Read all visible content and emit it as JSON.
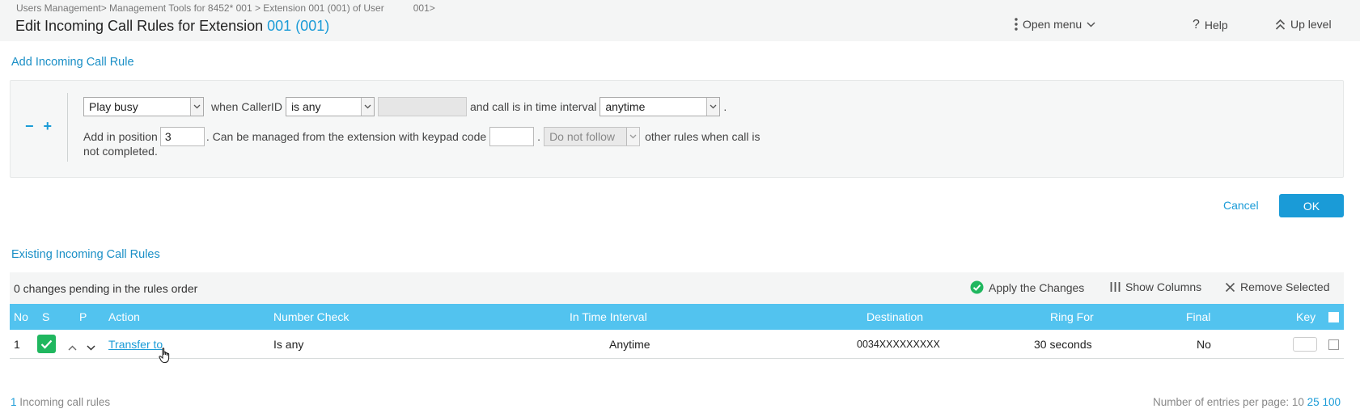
{
  "header": {
    "breadcrumb": "Users Management> Management Tools for 8452* 001 > Extension 001 (001) of User",
    "breadcrumb_tail": "001>",
    "title": "Edit Incoming Call Rules for Extension",
    "title_ext": "001 (001)",
    "open_menu": "Open menu",
    "help": "Help",
    "up_level": "Up level"
  },
  "add_rule": {
    "section_title": "Add Incoming Call Rule",
    "minus": "−",
    "plus": "+",
    "action_value": "Play busy",
    "when_callerid": "when CallerID",
    "callerid_condition": "is any",
    "callerid_value": "",
    "and_call_time": "and call is in time interval",
    "time_interval": "anytime",
    "period": ".",
    "add_in_position": "Add in position",
    "position_value": "3",
    "managed_text": ". Can be managed from the extension with keypad code",
    "keypad_code": "",
    "follow_value": "Do not follow",
    "other_rules_text": "other rules when call is",
    "not_completed": "not completed.",
    "cancel": "Cancel",
    "ok": "OK"
  },
  "existing": {
    "section_title": "Existing Incoming Call Rules",
    "changes_pending": "0 changes pending in the rules order",
    "apply_changes": "Apply the Changes",
    "show_columns": "Show Columns",
    "remove_selected": "Remove Selected",
    "columns": {
      "no": "No",
      "s": "S",
      "p": "P",
      "action": "Action",
      "number_check": "Number Check",
      "in_time_interval": "In Time Interval",
      "destination": "Destination",
      "ring_for": "Ring For",
      "final": "Final",
      "key": "Key"
    },
    "rows": [
      {
        "no": "1",
        "action": "Transfer to",
        "number_check": "Is any",
        "in_time_interval": "Anytime",
        "destination": "0034XXXXXXXXX",
        "ring_for": "30 seconds",
        "final": "No"
      }
    ]
  },
  "footer": {
    "count": "1",
    "count_label": "Incoming call rules",
    "per_page_label": "Number of entries per page:",
    "per_page_current": "10",
    "per_page_opt1": "25",
    "per_page_opt2": "100"
  },
  "colors": {
    "accent": "#1a9bd7",
    "table_header": "#52c3ef",
    "status_green": "#20b75f"
  }
}
